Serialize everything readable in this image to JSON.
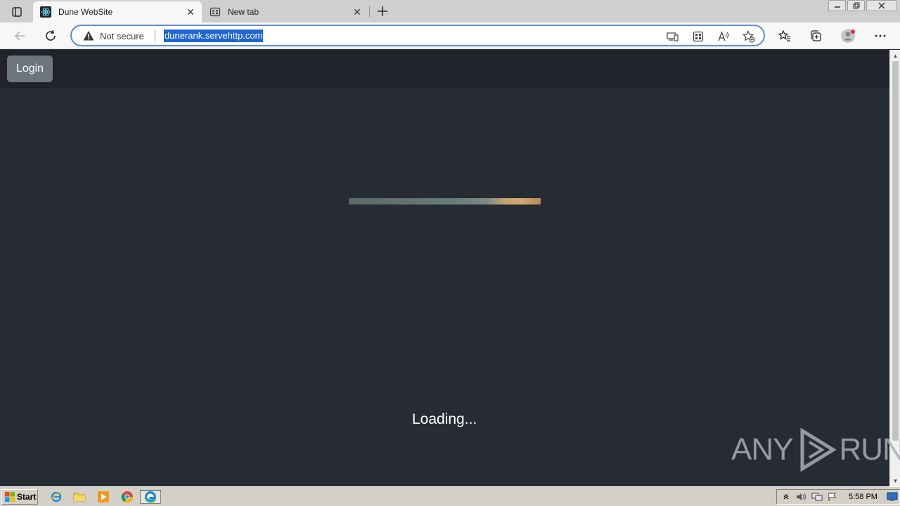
{
  "browser": {
    "tabs": [
      {
        "title": "Dune WebSite",
        "active": true,
        "icon": "react-favicon-icon"
      },
      {
        "title": "New tab",
        "active": false,
        "icon": "newtab-page-icon"
      }
    ],
    "address": {
      "security_label": "Not secure",
      "url": "dunerank.servehttp.com"
    }
  },
  "page": {
    "login_label": "Login",
    "loading_text": "Loading...",
    "background_color": "#272b34",
    "header_color": "#202329"
  },
  "watermark": {
    "left": "ANY",
    "right": "RUN"
  },
  "taskbar": {
    "start_label": "Start",
    "clock": "5:58 PM",
    "apps": [
      "internet-explorer-icon",
      "folder-icon",
      "media-player-icon",
      "chrome-icon",
      "edge-icon"
    ]
  }
}
